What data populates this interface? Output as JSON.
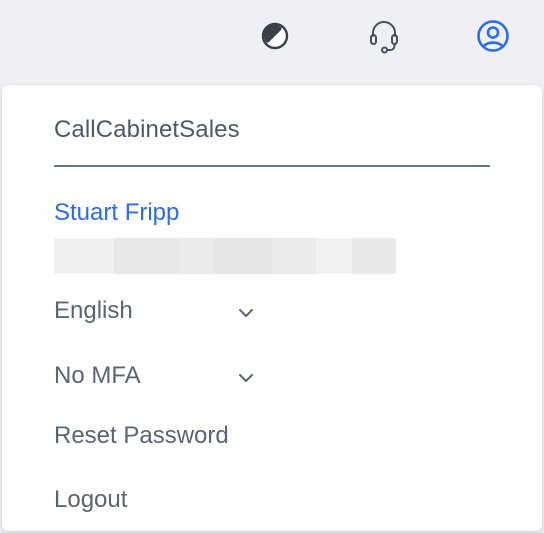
{
  "topbar": {
    "icons": [
      "theme-toggle-icon",
      "headset-icon",
      "user-circle-icon"
    ],
    "accent_color": "#2f6be6"
  },
  "dropdown": {
    "organization": "CallCabinetSales",
    "user_name": "Stuart Fripp",
    "language": "English",
    "mfa": "No MFA",
    "reset_password": "Reset Password",
    "logout": "Logout"
  }
}
